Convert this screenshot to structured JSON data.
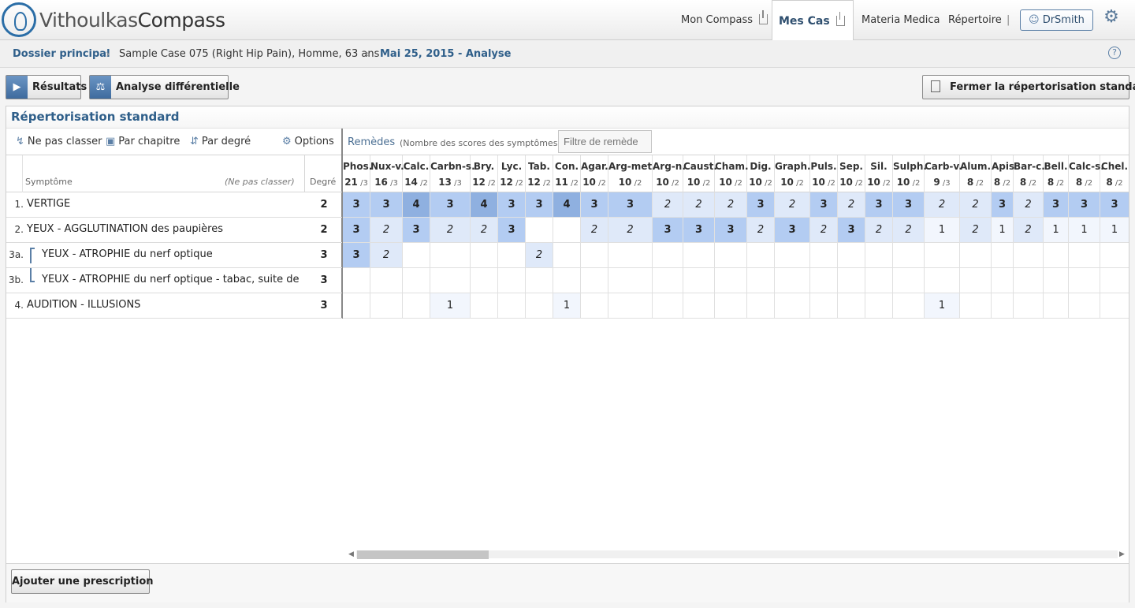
{
  "app": {
    "logo_part1": "Vithoulkas",
    "logo_part2": "Compass"
  },
  "nav": {
    "mon_compass": "Mon Compass",
    "mes_cas": "Mes Cas",
    "materia_medica": "Materia Medica",
    "repertoire": "Répertoire",
    "separator": "|",
    "user": "DrSmith"
  },
  "breadcrumb": {
    "root": "Dossier principal",
    "case": "Sample Case 075 (Right Hip Pain), Homme, 63 ans",
    "current": "Mai 25, 2015 - Analyse"
  },
  "toolbar": {
    "results": "Résultats",
    "differential": "Analyse différentielle",
    "close": "Fermer la répertorisation standard"
  },
  "panel": {
    "title": "Répertorisation standard",
    "sort_none": "Ne pas classer",
    "sort_chapter": "Par chapitre",
    "sort_degree": "Par degré",
    "options": "Options",
    "remedies_label": "Remèdes",
    "remedies_note": "(Nombre des scores des symptômes)",
    "filter_placeholder": "Filtre de remède",
    "col_symptom": "Symptôme",
    "col_nosort": "(Ne pas classer)",
    "col_degree": "Degré"
  },
  "symptoms": [
    {
      "num": "1.",
      "text": "VERTIGE",
      "degree": "2",
      "sub": false
    },
    {
      "num": "2.",
      "text": "YEUX - AGGLUTINATION des paupières",
      "degree": "2",
      "sub": false
    },
    {
      "num": "3a.",
      "text": "YEUX - ATROPHIE du nerf optique",
      "degree": "3",
      "sub": true
    },
    {
      "num": "3b.",
      "text": "YEUX - ATROPHIE du nerf optique - tabac, suite de",
      "degree": "3",
      "sub": true
    },
    {
      "num": "4.",
      "text": "AUDITION - ILLUSIONS",
      "degree": "3",
      "sub": false
    }
  ],
  "remedies": [
    {
      "name": "Phos.",
      "score": "21",
      "count": "/3",
      "cells": [
        "3",
        "3",
        "3",
        "",
        ""
      ]
    },
    {
      "name": "Nux-v.",
      "score": "16",
      "count": "/3",
      "cells": [
        "3",
        "2",
        "2",
        "",
        ""
      ]
    },
    {
      "name": "Calc.",
      "score": "14",
      "count": "/2",
      "cells": [
        "4",
        "3",
        "",
        "",
        ""
      ]
    },
    {
      "name": "Carbn-s.",
      "score": "13",
      "count": "/3",
      "cells": [
        "3",
        "2",
        "",
        "",
        "1"
      ]
    },
    {
      "name": "Bry.",
      "score": "12",
      "count": "/2",
      "cells": [
        "4",
        "2",
        "",
        "",
        ""
      ]
    },
    {
      "name": "Lyc.",
      "score": "12",
      "count": "/2",
      "cells": [
        "3",
        "3",
        "",
        "",
        ""
      ]
    },
    {
      "name": "Tab.",
      "score": "12",
      "count": "/2",
      "cells": [
        "3",
        "",
        "2",
        "",
        ""
      ]
    },
    {
      "name": "Con.",
      "score": "11",
      "count": "/2",
      "cells": [
        "4",
        "",
        "",
        "",
        "1"
      ]
    },
    {
      "name": "Agar.",
      "score": "10",
      "count": "/2",
      "cells": [
        "3",
        "2",
        "",
        "",
        ""
      ]
    },
    {
      "name": "Arg-met.",
      "score": "10",
      "count": "/2",
      "cells": [
        "3",
        "2",
        "",
        "",
        ""
      ]
    },
    {
      "name": "Arg-n.",
      "score": "10",
      "count": "/2",
      "cells": [
        "2",
        "3",
        "",
        "",
        ""
      ]
    },
    {
      "name": "Caust.",
      "score": "10",
      "count": "/2",
      "cells": [
        "2",
        "3",
        "",
        "",
        ""
      ]
    },
    {
      "name": "Cham.",
      "score": "10",
      "count": "/2",
      "cells": [
        "2",
        "3",
        "",
        "",
        ""
      ]
    },
    {
      "name": "Dig.",
      "score": "10",
      "count": "/2",
      "cells": [
        "3",
        "2",
        "",
        "",
        ""
      ]
    },
    {
      "name": "Graph.",
      "score": "10",
      "count": "/2",
      "cells": [
        "2",
        "3",
        "",
        "",
        ""
      ]
    },
    {
      "name": "Puls.",
      "score": "10",
      "count": "/2",
      "cells": [
        "3",
        "2",
        "",
        "",
        ""
      ]
    },
    {
      "name": "Sep.",
      "score": "10",
      "count": "/2",
      "cells": [
        "2",
        "3",
        "",
        "",
        ""
      ]
    },
    {
      "name": "Sil.",
      "score": "10",
      "count": "/2",
      "cells": [
        "3",
        "2",
        "",
        "",
        ""
      ]
    },
    {
      "name": "Sulph.",
      "score": "10",
      "count": "/2",
      "cells": [
        "3",
        "2",
        "",
        "",
        ""
      ]
    },
    {
      "name": "Carb-v.",
      "score": "9",
      "count": "/3",
      "cells": [
        "2",
        "1",
        "",
        "",
        "1"
      ]
    },
    {
      "name": "Alum.",
      "score": "8",
      "count": "/2",
      "cells": [
        "2",
        "2",
        "",
        "",
        ""
      ]
    },
    {
      "name": "Apis",
      "score": "8",
      "count": "/2",
      "cells": [
        "3",
        "1",
        "",
        "",
        ""
      ]
    },
    {
      "name": "Bar-c.",
      "score": "8",
      "count": "/2",
      "cells": [
        "2",
        "2",
        "",
        "",
        ""
      ]
    },
    {
      "name": "Bell.",
      "score": "8",
      "count": "/2",
      "cells": [
        "3",
        "1",
        "",
        "",
        ""
      ]
    },
    {
      "name": "Calc-s.",
      "score": "8",
      "count": "/2",
      "cells": [
        "3",
        "1",
        "",
        "",
        ""
      ]
    },
    {
      "name": "Chel.",
      "score": "8",
      "count": "/2",
      "cells": [
        "3",
        "1",
        "",
        "",
        ""
      ]
    }
  ],
  "footer": {
    "add_prescription": "Ajouter une prescription"
  },
  "colors": {
    "grade4": "#8fb0e0",
    "grade3": "#b3ccf2",
    "grade2": "#dfe9f9",
    "grade1": "#f2f6fd",
    "accent": "#2f5f8a"
  }
}
